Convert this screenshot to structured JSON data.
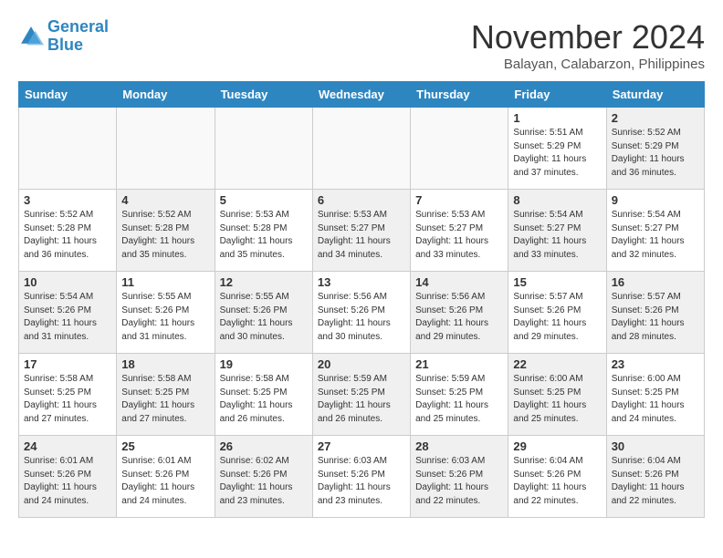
{
  "header": {
    "logo_line1": "General",
    "logo_line2": "Blue",
    "month": "November 2024",
    "location": "Balayan, Calabarzon, Philippines"
  },
  "weekdays": [
    "Sunday",
    "Monday",
    "Tuesday",
    "Wednesday",
    "Thursday",
    "Friday",
    "Saturday"
  ],
  "weeks": [
    [
      {
        "day": "",
        "info": ""
      },
      {
        "day": "",
        "info": ""
      },
      {
        "day": "",
        "info": ""
      },
      {
        "day": "",
        "info": ""
      },
      {
        "day": "",
        "info": ""
      },
      {
        "day": "1",
        "info": "Sunrise: 5:51 AM\nSunset: 5:29 PM\nDaylight: 11 hours\nand 37 minutes."
      },
      {
        "day": "2",
        "info": "Sunrise: 5:52 AM\nSunset: 5:29 PM\nDaylight: 11 hours\nand 36 minutes."
      }
    ],
    [
      {
        "day": "3",
        "info": "Sunrise: 5:52 AM\nSunset: 5:28 PM\nDaylight: 11 hours\nand 36 minutes."
      },
      {
        "day": "4",
        "info": "Sunrise: 5:52 AM\nSunset: 5:28 PM\nDaylight: 11 hours\nand 35 minutes."
      },
      {
        "day": "5",
        "info": "Sunrise: 5:53 AM\nSunset: 5:28 PM\nDaylight: 11 hours\nand 35 minutes."
      },
      {
        "day": "6",
        "info": "Sunrise: 5:53 AM\nSunset: 5:27 PM\nDaylight: 11 hours\nand 34 minutes."
      },
      {
        "day": "7",
        "info": "Sunrise: 5:53 AM\nSunset: 5:27 PM\nDaylight: 11 hours\nand 33 minutes."
      },
      {
        "day": "8",
        "info": "Sunrise: 5:54 AM\nSunset: 5:27 PM\nDaylight: 11 hours\nand 33 minutes."
      },
      {
        "day": "9",
        "info": "Sunrise: 5:54 AM\nSunset: 5:27 PM\nDaylight: 11 hours\nand 32 minutes."
      }
    ],
    [
      {
        "day": "10",
        "info": "Sunrise: 5:54 AM\nSunset: 5:26 PM\nDaylight: 11 hours\nand 31 minutes."
      },
      {
        "day": "11",
        "info": "Sunrise: 5:55 AM\nSunset: 5:26 PM\nDaylight: 11 hours\nand 31 minutes."
      },
      {
        "day": "12",
        "info": "Sunrise: 5:55 AM\nSunset: 5:26 PM\nDaylight: 11 hours\nand 30 minutes."
      },
      {
        "day": "13",
        "info": "Sunrise: 5:56 AM\nSunset: 5:26 PM\nDaylight: 11 hours\nand 30 minutes."
      },
      {
        "day": "14",
        "info": "Sunrise: 5:56 AM\nSunset: 5:26 PM\nDaylight: 11 hours\nand 29 minutes."
      },
      {
        "day": "15",
        "info": "Sunrise: 5:57 AM\nSunset: 5:26 PM\nDaylight: 11 hours\nand 29 minutes."
      },
      {
        "day": "16",
        "info": "Sunrise: 5:57 AM\nSunset: 5:26 PM\nDaylight: 11 hours\nand 28 minutes."
      }
    ],
    [
      {
        "day": "17",
        "info": "Sunrise: 5:58 AM\nSunset: 5:25 PM\nDaylight: 11 hours\nand 27 minutes."
      },
      {
        "day": "18",
        "info": "Sunrise: 5:58 AM\nSunset: 5:25 PM\nDaylight: 11 hours\nand 27 minutes."
      },
      {
        "day": "19",
        "info": "Sunrise: 5:58 AM\nSunset: 5:25 PM\nDaylight: 11 hours\nand 26 minutes."
      },
      {
        "day": "20",
        "info": "Sunrise: 5:59 AM\nSunset: 5:25 PM\nDaylight: 11 hours\nand 26 minutes."
      },
      {
        "day": "21",
        "info": "Sunrise: 5:59 AM\nSunset: 5:25 PM\nDaylight: 11 hours\nand 25 minutes."
      },
      {
        "day": "22",
        "info": "Sunrise: 6:00 AM\nSunset: 5:25 PM\nDaylight: 11 hours\nand 25 minutes."
      },
      {
        "day": "23",
        "info": "Sunrise: 6:00 AM\nSunset: 5:25 PM\nDaylight: 11 hours\nand 24 minutes."
      }
    ],
    [
      {
        "day": "24",
        "info": "Sunrise: 6:01 AM\nSunset: 5:26 PM\nDaylight: 11 hours\nand 24 minutes."
      },
      {
        "day": "25",
        "info": "Sunrise: 6:01 AM\nSunset: 5:26 PM\nDaylight: 11 hours\nand 24 minutes."
      },
      {
        "day": "26",
        "info": "Sunrise: 6:02 AM\nSunset: 5:26 PM\nDaylight: 11 hours\nand 23 minutes."
      },
      {
        "day": "27",
        "info": "Sunrise: 6:03 AM\nSunset: 5:26 PM\nDaylight: 11 hours\nand 23 minutes."
      },
      {
        "day": "28",
        "info": "Sunrise: 6:03 AM\nSunset: 5:26 PM\nDaylight: 11 hours\nand 22 minutes."
      },
      {
        "day": "29",
        "info": "Sunrise: 6:04 AM\nSunset: 5:26 PM\nDaylight: 11 hours\nand 22 minutes."
      },
      {
        "day": "30",
        "info": "Sunrise: 6:04 AM\nSunset: 5:26 PM\nDaylight: 11 hours\nand 22 minutes."
      }
    ]
  ]
}
